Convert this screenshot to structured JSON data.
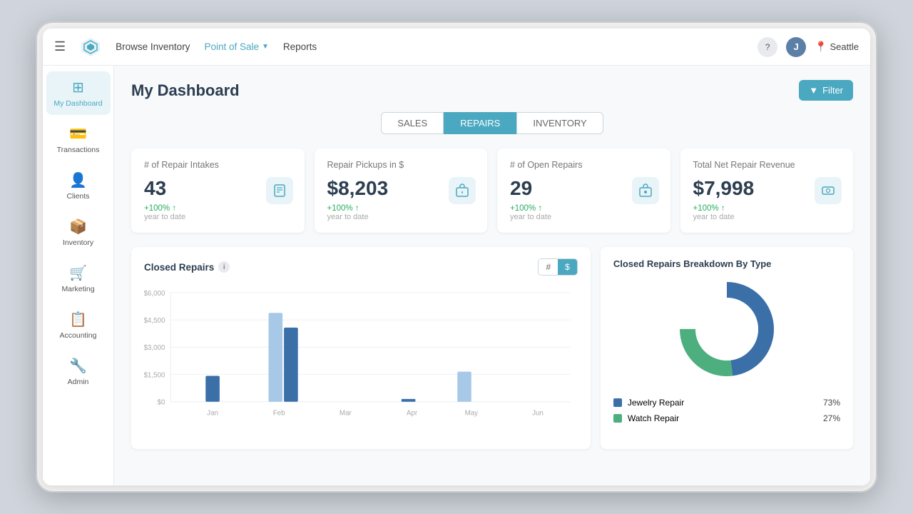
{
  "navbar": {
    "browse_inventory": "Browse Inventory",
    "point_of_sale": "Point of Sale",
    "reports": "Reports",
    "location": "Seattle",
    "user_initial": "J",
    "help_icon": "?",
    "location_pin": "📍"
  },
  "sidebar": {
    "items": [
      {
        "label": "My Dashboard",
        "icon": "📊",
        "active": true
      },
      {
        "label": "Transactions",
        "icon": "💳",
        "active": false
      },
      {
        "label": "Clients",
        "icon": "👤",
        "active": false
      },
      {
        "label": "Inventory",
        "icon": "📦",
        "active": false
      },
      {
        "label": "Marketing",
        "icon": "🛒",
        "active": false
      },
      {
        "label": "Accounting",
        "icon": "📋",
        "active": false
      },
      {
        "label": "Admin",
        "icon": "🔧",
        "active": false
      }
    ]
  },
  "page": {
    "title": "My Dashboard",
    "filter_btn": "Filter"
  },
  "tabs": [
    {
      "label": "SALES",
      "active": false
    },
    {
      "label": "REPAIRS",
      "active": true
    },
    {
      "label": "INVENTORY",
      "active": false
    }
  ],
  "kpi_cards": [
    {
      "title": "# of Repair Intakes",
      "value": "43",
      "change": "+100%",
      "period": "year to date",
      "icon": "📋"
    },
    {
      "title": "Repair Pickups in $",
      "value": "$8,203",
      "change": "+100%",
      "period": "year to date",
      "icon": "📤"
    },
    {
      "title": "# of Open Repairs",
      "value": "29",
      "change": "+100%",
      "period": "year to date",
      "icon": "🔧"
    },
    {
      "title": "Total Net Repair Revenue",
      "value": "$7,998",
      "change": "+100%",
      "period": "year to date",
      "icon": "💰"
    }
  ],
  "closed_repairs_chart": {
    "title": "Closed Repairs",
    "toggle_hash": "#",
    "toggle_dollar": "$",
    "y_labels": [
      "$6,000",
      "$4,500",
      "$3,000",
      "$1,500",
      "$0"
    ],
    "bars": [
      {
        "month": "Jan",
        "dark": 23,
        "light": 0
      },
      {
        "month": "Feb",
        "dark": 72,
        "light": 82
      },
      {
        "month": "Mar",
        "dark": 0,
        "light": 0
      },
      {
        "month": "Apr",
        "dark": 2,
        "light": 0
      },
      {
        "month": "May",
        "dark": 0,
        "light": 28
      },
      {
        "month": "Jun",
        "dark": 0,
        "light": 0
      }
    ]
  },
  "donut_chart": {
    "title": "Closed Repairs Breakdown By Type",
    "segments": [
      {
        "label": "Jewelry Repair",
        "pct": 73,
        "color": "#3a6fa8"
      },
      {
        "label": "Watch Repair",
        "pct": 27,
        "color": "#4caf7d"
      }
    ]
  }
}
